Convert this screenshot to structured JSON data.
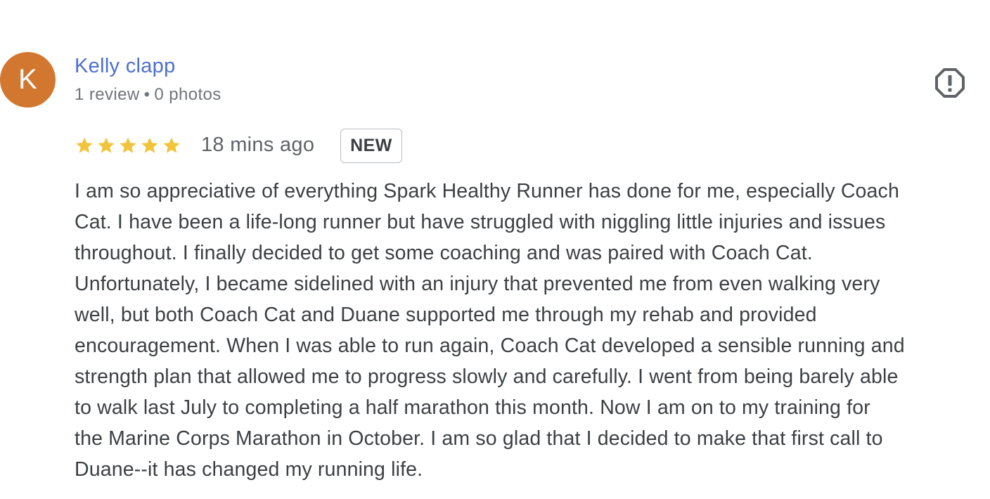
{
  "reviewer": {
    "initial": "K",
    "name": "Kelly clapp",
    "stats": {
      "reviews": "1 review",
      "separator": "•",
      "photos": "0 photos"
    },
    "avatar_color": "#d2772f"
  },
  "review": {
    "rating": 5,
    "max_rating": 5,
    "time": "18 mins ago",
    "badge": "NEW",
    "text_lines": [
      "I am so appreciative of everything Spark Healthy Runner has done for me, especially Coach",
      "Cat. I have been a life-long runner but have struggled with niggling little injuries and issues",
      "throughout. I finally decided to get some coaching and was paired with Coach Cat.",
      "Unfortunately, I became sidelined with an injury that prevented me from even walking very",
      "well, but both Coach Cat and Duane supported me through my rehab and provided",
      "encouragement. When I was able to run again, Coach Cat developed a sensible running and",
      "strength plan that allowed me to progress slowly and carefully. I went from being barely able",
      "to walk last July to completing a half marathon this month. Now I am on to my training for",
      "the Marine Corps Marathon in October. I am so glad that I decided to make that first call to",
      "Duane--it has changed my running life."
    ]
  },
  "icons": {
    "report": "report-flag-icon",
    "star": "star-icon"
  },
  "colors": {
    "name_link": "#4f6fd1",
    "star": "#f0c43c",
    "text": "#3c4043",
    "muted": "#70757a"
  }
}
